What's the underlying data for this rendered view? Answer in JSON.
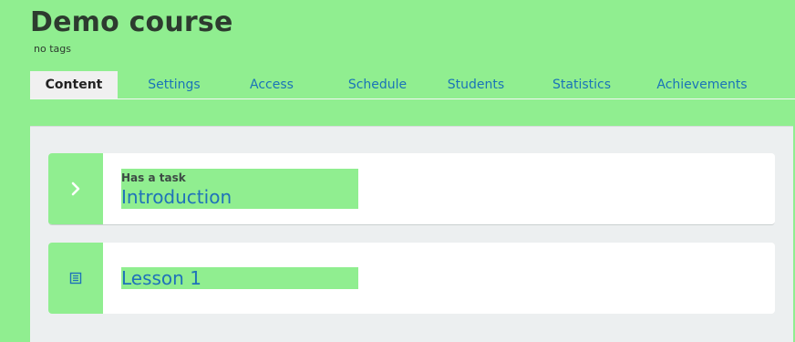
{
  "course": {
    "title": "Demo course",
    "tags": "no tags"
  },
  "tabs": [
    {
      "label": "Content",
      "active": true
    },
    {
      "label": "Settings",
      "active": false
    },
    {
      "label": "Access",
      "active": false
    },
    {
      "label": "Schedule",
      "active": false
    },
    {
      "label": "Students",
      "active": false
    },
    {
      "label": "Statistics",
      "active": false
    },
    {
      "label": "Achievements",
      "active": false
    }
  ],
  "items": [
    {
      "kicker": "Has a task",
      "title": "Introduction",
      "icon": "chevron-right-icon"
    },
    {
      "kicker": "",
      "title": "Lesson 1",
      "icon": "document-list-icon"
    }
  ],
  "colors": {
    "background": "#90ee90",
    "link": "#1f72b9",
    "panel": "#eceff0",
    "card": "#ffffff",
    "active_tab": "#f0f0f0"
  }
}
